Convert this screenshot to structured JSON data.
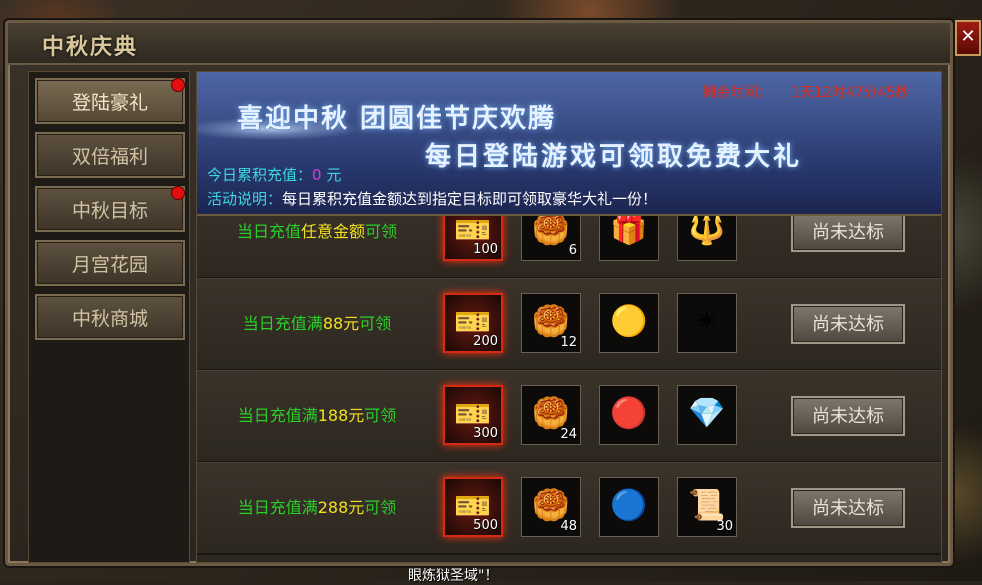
{
  "window": {
    "title": "中秋庆典",
    "close_label": "✕"
  },
  "sidebar": {
    "items": [
      {
        "label": "登陆豪礼",
        "active": true,
        "badge": true
      },
      {
        "label": "双倍福利",
        "active": false,
        "badge": false
      },
      {
        "label": "中秋目标",
        "active": false,
        "badge": true
      },
      {
        "label": "月宫花园",
        "active": false,
        "badge": false
      },
      {
        "label": "中秋商城",
        "active": false,
        "badge": false
      }
    ]
  },
  "banner": {
    "timer_label": "剩余时间：",
    "timer_value": "1天12时47分45秒",
    "slogan_line1": "喜迎中秋 团圆佳节庆欢腾",
    "slogan_line2": "每日登陆游戏可领取免费大礼",
    "recharge_label": "今日累积充值：",
    "recharge_value": "0",
    "recharge_unit": "元",
    "desc_label": "活动说明：",
    "desc_text": "每日累积充值金额达到指定目标即可领取豪华大礼一份！"
  },
  "rows": [
    {
      "prefix": "当日充值",
      "amount": "任意金额",
      "suffix": "可领",
      "items": [
        {
          "icon": "ticket-icon",
          "glyph": "🎫",
          "count": "100"
        },
        {
          "icon": "mooncake-icon",
          "glyph": "🥮",
          "count": "6"
        },
        {
          "icon": "treasure-chest-icon",
          "glyph": "🎁",
          "count": ""
        },
        {
          "icon": "golden-armor-icon",
          "glyph": "🔱",
          "count": ""
        }
      ],
      "button": "尚未达标"
    },
    {
      "prefix": "当日充值满",
      "amount": "88元",
      "suffix": "可领",
      "items": [
        {
          "icon": "ticket-icon",
          "glyph": "🎫",
          "count": "200"
        },
        {
          "icon": "mooncake-icon",
          "glyph": "🥮",
          "count": "12"
        },
        {
          "icon": "gold-orb-icon",
          "glyph": "🟡",
          "count": ""
        },
        {
          "icon": "golden-emblem-icon",
          "glyph": "✴",
          "count": ""
        }
      ],
      "button": "尚未达标"
    },
    {
      "prefix": "当日充值满",
      "amount": "188元",
      "suffix": "可领",
      "items": [
        {
          "icon": "ticket-icon",
          "glyph": "🎫",
          "count": "300"
        },
        {
          "icon": "mooncake-icon",
          "glyph": "🥮",
          "count": "24"
        },
        {
          "icon": "fire-orb-icon",
          "glyph": "🔴",
          "count": ""
        },
        {
          "icon": "rainbow-crystal-icon",
          "glyph": "💎",
          "count": ""
        }
      ],
      "button": "尚未达标"
    },
    {
      "prefix": "当日充值满",
      "amount": "288元",
      "suffix": "可领",
      "items": [
        {
          "icon": "ticket-icon",
          "glyph": "🎫",
          "count": "500"
        },
        {
          "icon": "mooncake-icon",
          "glyph": "🥮",
          "count": "48"
        },
        {
          "icon": "blue-dragon-orb-icon",
          "glyph": "🔵",
          "count": ""
        },
        {
          "icon": "red-scroll-icon",
          "glyph": "📜",
          "count": "30"
        }
      ],
      "button": "尚未达标"
    }
  ],
  "background_text": "眼炼狱圣域\"！",
  "colors": {
    "accent_green": "#28d028",
    "amount_yellow": "#f0e020",
    "timer_red": "#e02a1a",
    "cyan": "#3ed6e0"
  }
}
